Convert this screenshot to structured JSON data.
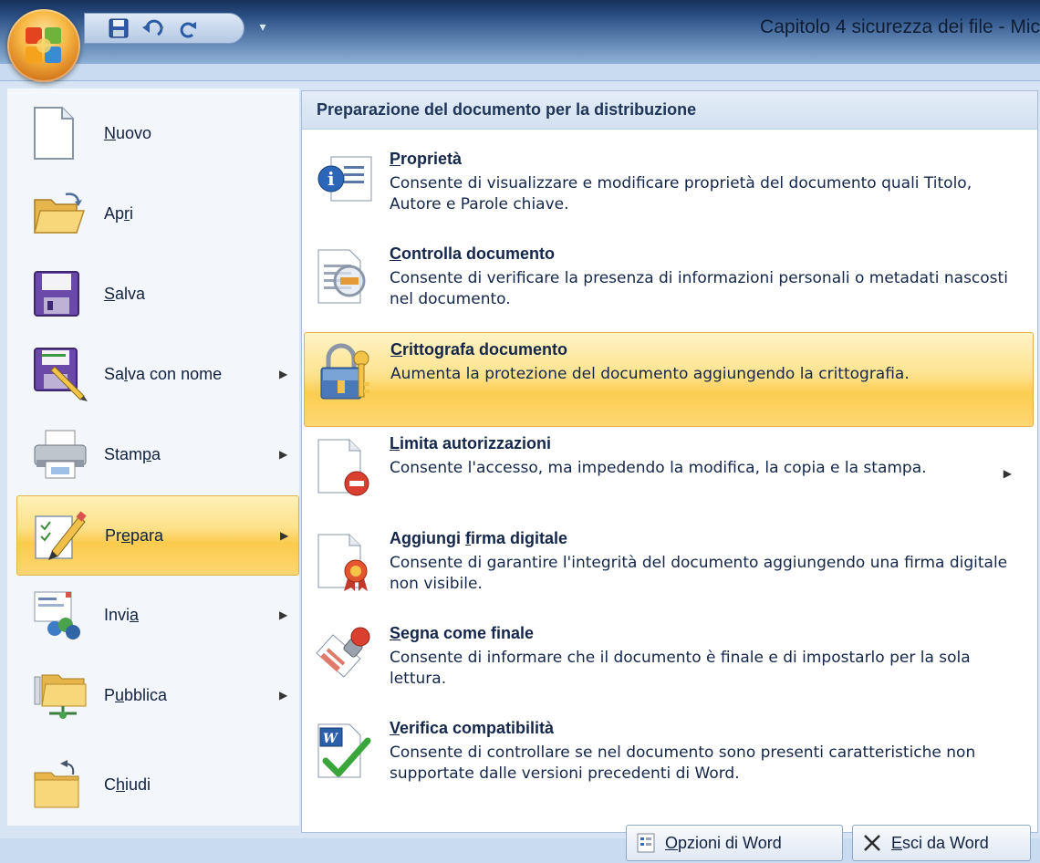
{
  "window": {
    "title": "Capitolo 4 sicurezza dei file - Mic"
  },
  "qat": {
    "items": [
      {
        "name": "save-icon"
      },
      {
        "name": "undo-icon"
      },
      {
        "name": "redo-icon"
      }
    ],
    "customize_icon": "dropdown-arrow-icon"
  },
  "left_menu": {
    "items": [
      {
        "label_pre": "",
        "label_u": "N",
        "label_post": "uovo",
        "icon": "blank-document-icon",
        "submenu": false
      },
      {
        "label_pre": "Ap",
        "label_u": "r",
        "label_post": "i",
        "icon": "open-folder-icon",
        "submenu": false
      },
      {
        "label_pre": "",
        "label_u": "S",
        "label_post": "alva",
        "icon": "save-icon",
        "submenu": false
      },
      {
        "label_pre": "Sa",
        "label_u": "l",
        "label_post": "va con nome",
        "icon": "save-as-icon",
        "submenu": true
      },
      {
        "label_pre": "Stam",
        "label_u": "p",
        "label_post": "a",
        "icon": "printer-icon",
        "submenu": true
      },
      {
        "label_pre": "Pr",
        "label_u": "e",
        "label_post": "para",
        "icon": "prepare-pencil-icon",
        "submenu": true,
        "active": true
      },
      {
        "label_pre": "Invi",
        "label_u": "a",
        "label_post": "",
        "icon": "send-icon",
        "submenu": true
      },
      {
        "label_pre": "P",
        "label_u": "u",
        "label_post": "bblica",
        "icon": "publish-icon",
        "submenu": true
      },
      {
        "label_pre": "C",
        "label_u": "h",
        "label_post": "iudi",
        "icon": "close-folder-icon",
        "submenu": false
      }
    ]
  },
  "prepare_panel": {
    "header": "Preparazione del documento per la distribuzione",
    "options": [
      {
        "t_pre": "",
        "t_u": "P",
        "t_post": "roprietà",
        "desc": "Consente di visualizzare e modificare proprietà del documento quali Titolo, Autore e Parole chiave.",
        "icon": "properties-info-icon",
        "submenu": false
      },
      {
        "t_pre": "",
        "t_u": "C",
        "t_post": "ontrolla documento",
        "desc": "Consente di verificare la presenza di informazioni personali o metadati nascosti nel documento.",
        "icon": "inspect-document-icon",
        "submenu": false
      },
      {
        "t_pre": "",
        "t_u": "C",
        "t_post": "rittografa documento",
        "desc": "Aumenta la protezione del documento aggiungendo la crittografia.",
        "icon": "lock-key-icon",
        "submenu": false,
        "active": true
      },
      {
        "t_pre": "",
        "t_u": "L",
        "t_post": "imita autorizzazioni",
        "desc": "Consente l'accesso, ma impedendo la modifica, la copia e la stampa.",
        "icon": "restrict-permission-icon",
        "submenu": true
      },
      {
        "t_pre": "Aggiungi ",
        "t_u": "f",
        "t_post": "irma digitale",
        "desc": "Consente di garantire l'integrità del documento aggiungendo una firma digitale non visibile.",
        "icon": "digital-signature-icon",
        "submenu": false
      },
      {
        "t_pre": "",
        "t_u": "S",
        "t_post": "egna come finale",
        "desc": "Consente di informare che il documento è finale e di impostarlo per la sola lettura.",
        "icon": "mark-final-icon",
        "submenu": false
      },
      {
        "t_pre": "",
        "t_u": "V",
        "t_post": "erifica compatibilità",
        "desc": "Consente di controllare se nel documento sono presenti caratteristiche non supportate dalle versioni precedenti di Word.",
        "icon": "compatibility-check-icon",
        "submenu": false
      }
    ]
  },
  "footer": {
    "options_btn": {
      "label_u": "O",
      "label_post": "pzioni di Word"
    },
    "exit_btn": {
      "label_u": "E",
      "label_post": "sci da Word"
    }
  },
  "colors": {
    "highlight": "#fbcb4d",
    "panel_bg": "#d6e4f4",
    "title_bar": "#2b4f83"
  }
}
